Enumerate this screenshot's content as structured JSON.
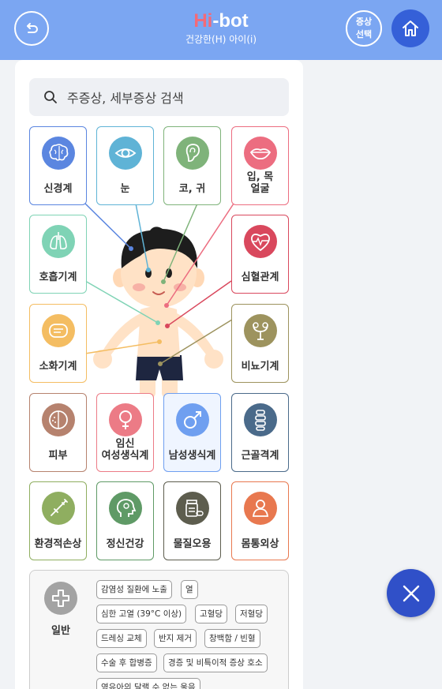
{
  "header": {
    "logo_hi": "Hi",
    "logo_rest": "-bot",
    "subtitle": "건강한(H) 아이(i)",
    "select_line1": "증상",
    "select_line2": "선택"
  },
  "search": {
    "placeholder": "주증상, 세부증상 검색"
  },
  "categories": [
    {
      "label": "신경계",
      "icon": "brain-icon",
      "color": "#5b86e0"
    },
    {
      "label": "눈",
      "icon": "eye-icon",
      "color": "#5fb3d6"
    },
    {
      "label": "코, 귀",
      "icon": "ear-icon",
      "color": "#7fb37a"
    },
    {
      "label": "입, 목",
      "label2": "얼굴",
      "icon": "lips-icon",
      "color": "#ec6d80"
    },
    {
      "label": "호흡기계",
      "icon": "lungs-icon",
      "color": "#7fd3b5"
    },
    {
      "label": "심혈관계",
      "icon": "heart-icon",
      "color": "#d9485d"
    },
    {
      "label": "소화기계",
      "icon": "stomach-icon",
      "color": "#f4bd62"
    },
    {
      "label": "비뇨기계",
      "icon": "kidney-icon",
      "color": "#9d935e"
    },
    {
      "label": "피부",
      "icon": "skin-face-icon",
      "color": "#b6826e"
    },
    {
      "label": "임신",
      "label2": "여성생식계",
      "icon": "female-icon",
      "color": "#ec7b86"
    },
    {
      "label": "남성생식계",
      "icon": "male-icon",
      "color": "#6f9ff0"
    },
    {
      "label": "근골격계",
      "icon": "spine-icon",
      "color": "#4a6a8a"
    },
    {
      "label": "환경적손상",
      "icon": "syringe-icon",
      "color": "#8fae60"
    },
    {
      "label": "정신건강",
      "icon": "mind-icon",
      "color": "#5f9a66"
    },
    {
      "label": "물질오용",
      "icon": "pill-bottle-icon",
      "color": "#5d5d4e"
    },
    {
      "label": "몸통외상",
      "icon": "person-icon",
      "color": "#e8784f"
    }
  ],
  "general": {
    "label": "일반",
    "chips": [
      "감염성 질환에 노출",
      "열",
      "심한 고열 (39°C 이상)",
      "고혈당",
      "저혈당",
      "드레싱 교체",
      "반지 제거",
      "창백함 / 빈혈",
      "수술 후 합병증",
      "경증 및 비특이적 증상 호소",
      "영유아의 달랠 수 없는 울음"
    ]
  },
  "colors": {
    "header_bg": "#7ba6f2",
    "home_bg": "#3560d8",
    "fab_bg": "#3050c8"
  }
}
